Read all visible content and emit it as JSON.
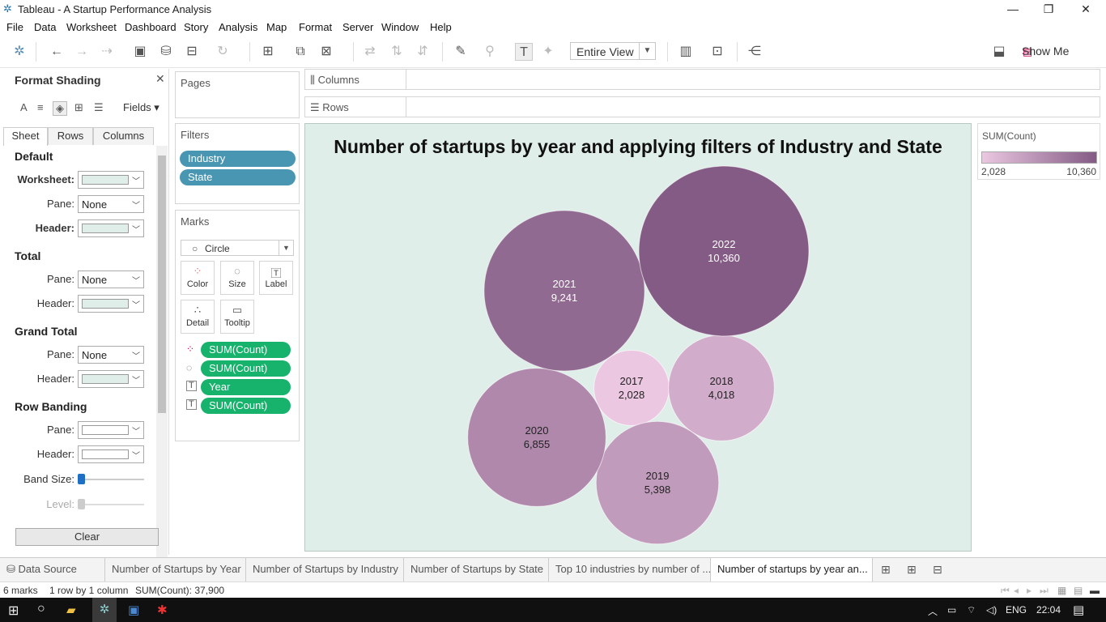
{
  "window": {
    "title": "Tableau - A Startup Performance Analysis"
  },
  "menu": [
    "File",
    "Data",
    "Worksheet",
    "Dashboard",
    "Story",
    "Analysis",
    "Map",
    "Format",
    "Server",
    "Window",
    "Help"
  ],
  "toolbar": {
    "view_select": "Entire View",
    "show_me": "Show Me"
  },
  "format_panel": {
    "title": "Format Shading",
    "fields_label": "Fields",
    "tabs": [
      "Sheet",
      "Rows",
      "Columns"
    ],
    "sections": {
      "default": "Default",
      "total": "Total",
      "grand_total": "Grand Total",
      "row_banding": "Row Banding"
    },
    "labels": {
      "worksheet": "Worksheet:",
      "pane": "Pane:",
      "header": "Header:",
      "band_size": "Band Size:",
      "level": "Level:"
    },
    "pane_none": "None",
    "clear_button": "Clear"
  },
  "cards": {
    "pages": "Pages",
    "filters": "Filters",
    "filter_pills": [
      "Industry",
      "State"
    ],
    "marks": "Marks",
    "mark_type": "Circle",
    "mark_buttons": [
      "Color",
      "Size",
      "Label",
      "Detail",
      "Tooltip"
    ],
    "mark_pills": [
      "SUM(Count)",
      "SUM(Count)",
      "Year",
      "SUM(Count)"
    ]
  },
  "shelves": {
    "columns": "Columns",
    "rows": "Rows"
  },
  "colors": {
    "shading_bg": "#e0eee9",
    "accent_pill_blue": "#4996b2",
    "accent_pill_green": "#17b26c",
    "color_low": "#ebc7e1",
    "color_high": "#835b85"
  },
  "chart_data": {
    "type": "packed-bubble",
    "title": "Number of startups by year and applying filters of Industry and State",
    "points": [
      {
        "label": "2017",
        "value": 2028
      },
      {
        "label": "2018",
        "value": 4018
      },
      {
        "label": "2019",
        "value": 5398
      },
      {
        "label": "2020",
        "value": 6855
      },
      {
        "label": "2021",
        "value": 9241
      },
      {
        "label": "2022",
        "value": 10360
      }
    ],
    "value_labels": [
      "2,028",
      "4,018",
      "5,398",
      "6,855",
      "9,241",
      "10,360"
    ],
    "legend": {
      "title": "SUM(Count)",
      "min_label": "2,028",
      "max_label": "10,360",
      "placement": "top-right"
    }
  },
  "sheet_tabs": [
    "Data Source",
    "Number of Startups by Year",
    "Number of Startups by Industry",
    "Number of Startups by State",
    "Top 10 industries by number of ...",
    "Number of startups by year an..."
  ],
  "status": {
    "marks": "6 marks",
    "rows_cols": "1 row by 1 column",
    "sum": "SUM(Count): 37,900"
  },
  "taskbar": {
    "lang": "ENG",
    "time": "22:04"
  }
}
